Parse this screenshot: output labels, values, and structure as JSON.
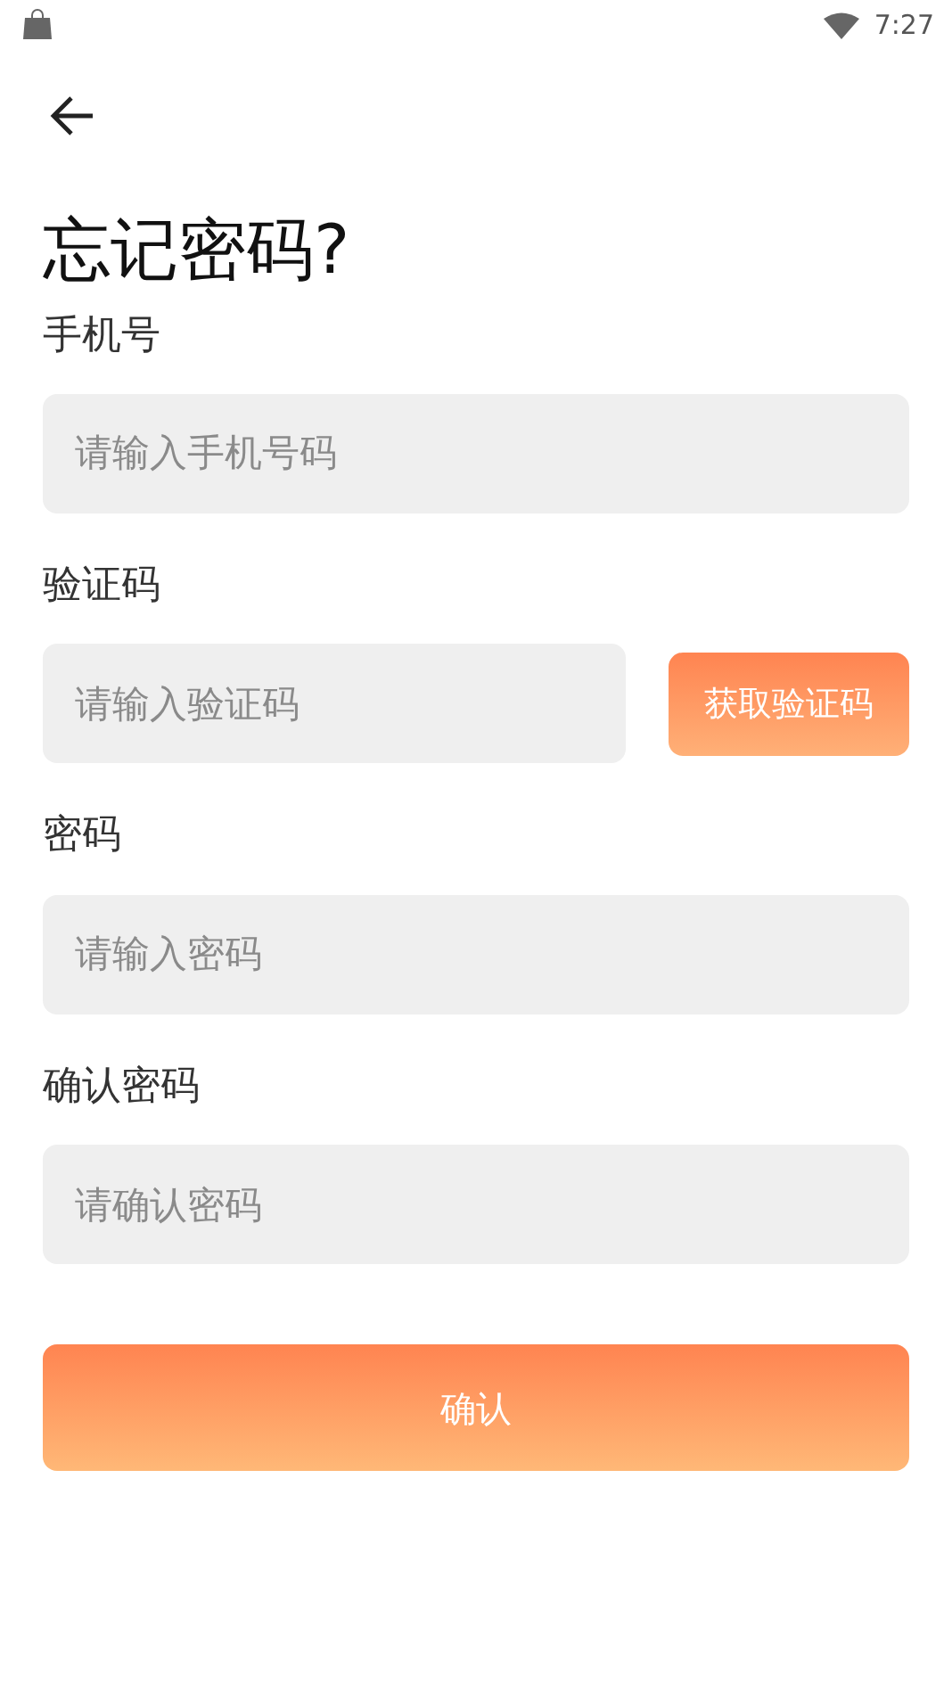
{
  "status_bar": {
    "time": "7:27"
  },
  "title": "忘记密码?",
  "fields": [
    {
      "kind": "text",
      "label": "手机号",
      "placeholder": "请输入手机号码"
    },
    {
      "kind": "code",
      "label": "验证码",
      "placeholder": "请输入验证码",
      "button": "获取验证码"
    },
    {
      "kind": "text",
      "label": "密码",
      "placeholder": "请输入密码"
    },
    {
      "kind": "text",
      "label": "确认密码",
      "placeholder": "请确认密码"
    }
  ],
  "submit": "确认"
}
